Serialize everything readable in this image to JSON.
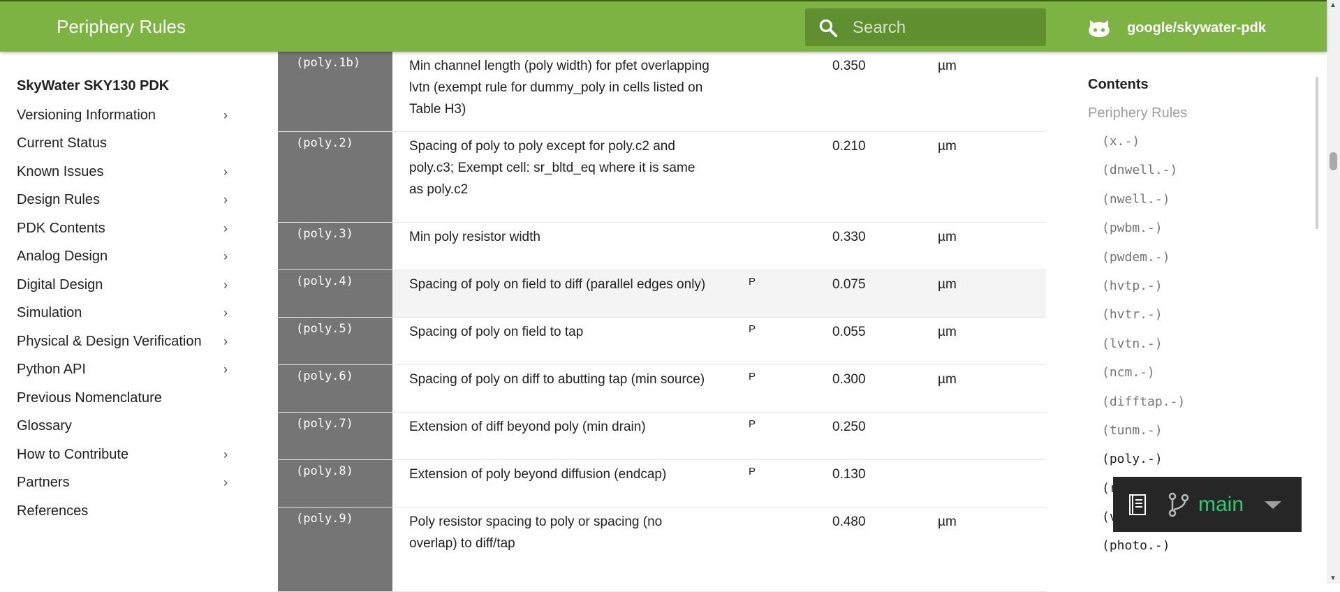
{
  "header": {
    "title": "Periphery Rules",
    "search_placeholder": "Search",
    "repo": "google/skywater-pdk"
  },
  "sidebar": {
    "heading": "SkyWater SKY130 PDK",
    "items": [
      {
        "label": "Versioning Information",
        "expandable": true
      },
      {
        "label": "Current Status",
        "expandable": false
      },
      {
        "label": "Known Issues",
        "expandable": true
      },
      {
        "label": "Design Rules",
        "expandable": true
      },
      {
        "label": "PDK Contents",
        "expandable": true
      },
      {
        "label": "Analog Design",
        "expandable": true
      },
      {
        "label": "Digital Design",
        "expandable": true
      },
      {
        "label": "Simulation",
        "expandable": true
      },
      {
        "label": "Physical & Design Verification",
        "expandable": true
      },
      {
        "label": "Python API",
        "expandable": true
      },
      {
        "label": "Previous Nomenclature",
        "expandable": false
      },
      {
        "label": "Glossary",
        "expandable": false
      },
      {
        "label": "How to Contribute",
        "expandable": true
      },
      {
        "label": "Partners",
        "expandable": true
      },
      {
        "label": "References",
        "expandable": false
      }
    ]
  },
  "rules": [
    {
      "code": "(poly.1b)",
      "desc": "Min channel length (poly width) for pfet overlapping lvtn (exempt rule for dummy_poly in cells listed on Table H3)",
      "flag": "",
      "value": "0.350",
      "unit": "µm"
    },
    {
      "code": "(poly.2)",
      "desc": "Spacing of poly to poly except for poly.c2 and poly.c3; Exempt cell: sr_bltd_eq where it is same as poly.c2",
      "flag": "",
      "value": "0.210",
      "unit": "µm"
    },
    {
      "code": "(poly.3)",
      "desc": "Min poly resistor width",
      "flag": "",
      "value": "0.330",
      "unit": "µm"
    },
    {
      "code": "(poly.4)",
      "desc": "Spacing of poly on field to diff (parallel edges only)",
      "flag": "P",
      "value": "0.075",
      "unit": "µm"
    },
    {
      "code": "(poly.5)",
      "desc": "Spacing of poly on field to tap",
      "flag": "P",
      "value": "0.055",
      "unit": "µm"
    },
    {
      "code": "(poly.6)",
      "desc": "Spacing of poly on diff to abutting tap (min source)",
      "flag": "P",
      "value": "0.300",
      "unit": "µm"
    },
    {
      "code": "(poly.7)",
      "desc": "Extension of diff beyond poly (min drain)",
      "flag": "P",
      "value": "0.250",
      "unit": ""
    },
    {
      "code": "(poly.8)",
      "desc": "Extension of poly beyond diffusion (endcap)",
      "flag": "P",
      "value": "0.130",
      "unit": ""
    },
    {
      "code": "(poly.9)",
      "desc": "Poly resistor spacing to poly or spacing (no overlap) to diff/tap",
      "flag": "",
      "value": "0.480",
      "unit": "µm"
    }
  ],
  "toc": {
    "title": "Contents",
    "page": "Periphery Rules",
    "items": [
      "(x.-)",
      "(dnwell.-)",
      "(nwell.-)",
      "(pwbm.-)",
      "(pwdem.-)",
      "(hvtp.-)",
      "(hvtr.-)",
      "(lvtn.-)",
      "(ncm.-)",
      "(difftap.-)",
      "(tunm.-)",
      "(poly.-)",
      "(r",
      "(v",
      "(photo.-)"
    ],
    "active": "(poly.-)"
  },
  "version_widget": {
    "branch": "main"
  },
  "colors": {
    "header": "#7cb342",
    "code_cell": "#757575",
    "branch_text": "#2ecc71",
    "widget_bg": "#262626"
  }
}
